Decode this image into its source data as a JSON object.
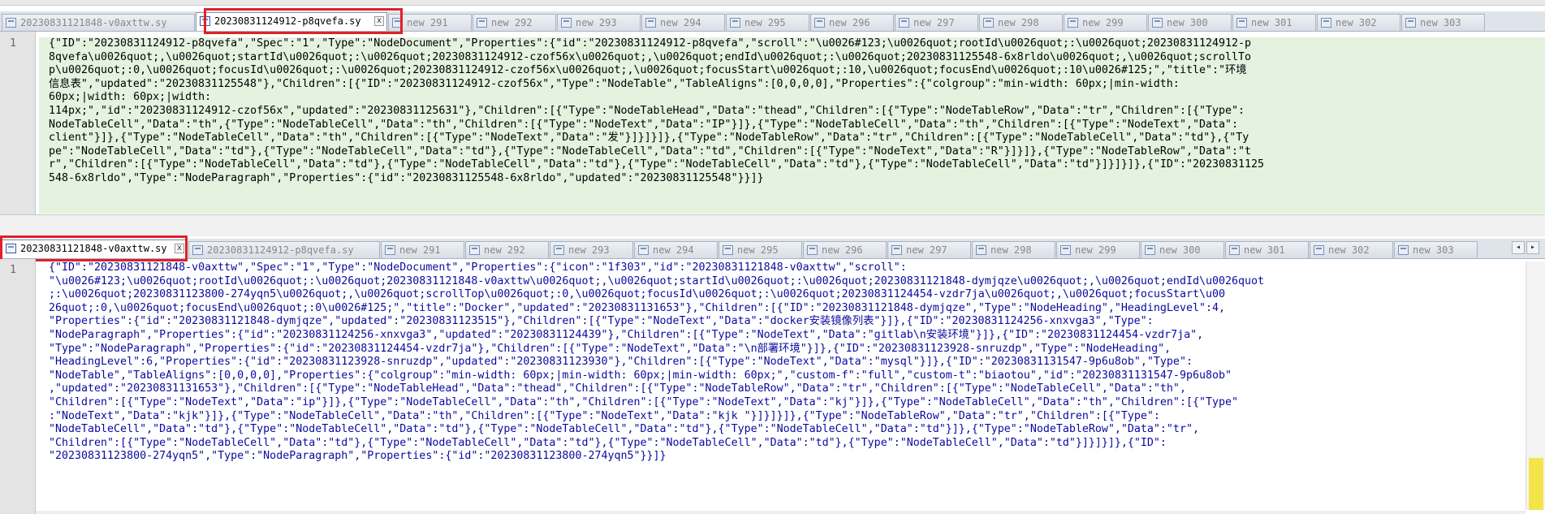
{
  "pane1": {
    "tabs": [
      {
        "label": "20230831121848-v0axttw.sy",
        "active": false
      },
      {
        "label": "20230831124912-p8qvefa.sy",
        "active": true
      },
      {
        "label": "new 291",
        "active": false
      },
      {
        "label": "new 292",
        "active": false
      },
      {
        "label": "new 293",
        "active": false
      },
      {
        "label": "new 294",
        "active": false
      },
      {
        "label": "new 295",
        "active": false
      },
      {
        "label": "new 296",
        "active": false
      },
      {
        "label": "new 297",
        "active": false
      },
      {
        "label": "new 298",
        "active": false
      },
      {
        "label": "new 299",
        "active": false
      },
      {
        "label": "new 300",
        "active": false
      },
      {
        "label": "new 301",
        "active": false
      },
      {
        "label": "new 302",
        "active": false
      },
      {
        "label": "new 303",
        "active": false
      }
    ],
    "line_number": "1",
    "close_label": "x",
    "lines": [
      "{\"ID\":\"20230831124912-p8qvefa\",\"Spec\":\"1\",\"Type\":\"NodeDocument\",\"Properties\":{\"id\":\"20230831124912-p8qvefa\",\"scroll\":\"\\u0026#123;\\u0026quot;rootId\\u0026quot;:\\u0026quot;20230831124912-p",
      "8qvefa\\u0026quot;,\\u0026quot;startId\\u0026quot;:\\u0026quot;20230831124912-czof56x\\u0026quot;,\\u0026quot;endId\\u0026quot;:\\u0026quot;20230831125548-6x8rldo\\u0026quot;,\\u0026quot;scrollTo",
      "p\\u0026quot;:0,\\u0026quot;focusId\\u0026quot;:\\u0026quot;20230831124912-czof56x\\u0026quot;,\\u0026quot;focusStart\\u0026quot;:10,\\u0026quot;focusEnd\\u0026quot;:10\\u0026#125;\",\"title\":\"环境",
      "信息表\",\"updated\":\"20230831125548\"},\"Children\":[{\"ID\":\"20230831124912-czof56x\",\"Type\":\"NodeTable\",\"TableAligns\":[0,0,0,0],\"Properties\":{\"colgroup\":\"min-width: 60px;|min-width:",
      "60px;|width: 60px;|width:",
      "114px;\",\"id\":\"20230831124912-czof56x\",\"updated\":\"20230831125631\"},\"Children\":[{\"Type\":\"NodeTableHead\",\"Data\":\"thead\",\"Children\":[{\"Type\":\"NodeTableRow\",\"Data\":\"tr\",\"Children\":[{\"Type\":",
      "NodeTableCell\",\"Data\":\"th\",{\"Type\":\"NodeTableCell\",\"Data\":\"th\",\"Children\":[{\"Type\":\"NodeText\",\"Data\":\"IP\"}]},{\"Type\":\"NodeTableCell\",\"Data\":\"th\",\"Children\":[{\"Type\":\"NodeText\",\"Data\":",
      "client\"}]},{\"Type\":\"NodeTableCell\",\"Data\":\"th\",\"Children\":[{\"Type\":\"NodeText\",\"Data\":\"发\"}]}]}]},{\"Type\":\"NodeTableRow\",\"Data\":\"tr\",\"Children\":[{\"Type\":\"NodeTableCell\",\"Data\":\"td\"},{\"Ty",
      "pe\":\"NodeTableCell\",\"Data\":\"td\"},{\"Type\":\"NodeTableCell\",\"Data\":\"td\"},{\"Type\":\"NodeTableCell\",\"Data\":\"td\",\"Children\":[{\"Type\":\"NodeText\",\"Data\":\"R\"}]}]},{\"Type\":\"NodeTableRow\",\"Data\":\"t",
      "r\",\"Children\":[{\"Type\":\"NodeTableCell\",\"Data\":\"td\"},{\"Type\":\"NodeTableCell\",\"Data\":\"td\"},{\"Type\":\"NodeTableCell\",\"Data\":\"td\"},{\"Type\":\"NodeTableCell\",\"Data\":\"td\"}]}]}]},{\"ID\":\"20230831125",
      "548-6x8rldo\",\"Type\":\"NodeParagraph\",\"Properties\":{\"id\":\"20230831125548-6x8rldo\",\"updated\":\"20230831125548\"}}]}"
    ]
  },
  "pane2": {
    "tabs": [
      {
        "label": "20230831121848-v0axttw.sy",
        "active": true
      },
      {
        "label": "20230831124912-p8qvefa.sy",
        "active": false
      },
      {
        "label": "new 291",
        "active": false
      },
      {
        "label": "new 292",
        "active": false
      },
      {
        "label": "new 293",
        "active": false
      },
      {
        "label": "new 294",
        "active": false
      },
      {
        "label": "new 295",
        "active": false
      },
      {
        "label": "new 296",
        "active": false
      },
      {
        "label": "new 297",
        "active": false
      },
      {
        "label": "new 298",
        "active": false
      },
      {
        "label": "new 299",
        "active": false
      },
      {
        "label": "new 300",
        "active": false
      },
      {
        "label": "new 301",
        "active": false
      },
      {
        "label": "new 302",
        "active": false
      },
      {
        "label": "new 303",
        "active": false
      }
    ],
    "line_number": "1",
    "close_label": "x",
    "nav_left": "◂",
    "nav_right": "▸",
    "lines": [
      "{\"ID\":\"20230831121848-v0axttw\",\"Spec\":\"1\",\"Type\":\"NodeDocument\",\"Properties\":{\"icon\":\"1f303\",\"id\":\"20230831121848-v0axttw\",\"scroll\":",
      "\"\\u0026#123;\\u0026quot;rootId\\u0026quot;:\\u0026quot;20230831121848-v0axttw\\u0026quot;,\\u0026quot;startId\\u0026quot;:\\u0026quot;20230831121848-dymjqze\\u0026quot;,\\u0026quot;endId\\u0026quot",
      ";:\\u0026quot;20230831123800-274yqn5\\u0026quot;,\\u0026quot;scrollTop\\u0026quot;:0,\\u0026quot;focusId\\u0026quot;:\\u0026quot;20230831124454-vzdr7ja\\u0026quot;,\\u0026quot;focusStart\\u00",
      "26quot;:0,\\u0026quot;focusEnd\\u0026quot;:0\\u0026#125;\",\"title\":\"Docker\",\"updated\":\"20230831131653\"},\"Children\":[{\"ID\":\"20230831121848-dymjqze\",\"Type\":\"NodeHeading\",\"HeadingLevel\":4,",
      "\"Properties\":{\"id\":\"20230831121848-dymjqze\",\"updated\":\"20230831123515\"},\"Children\":[{\"Type\":\"NodeText\",\"Data\":\"docker安装镜像列表\"}]},{\"ID\":\"20230831124256-xnxvga3\",\"Type\":",
      "\"NodeParagraph\",\"Properties\":{\"id\":\"20230831124256-xnxvga3\",\"updated\":\"20230831124439\"},\"Children\":[{\"Type\":\"NodeText\",\"Data\":\"gitlab\\n安装环境\"}]},{\"ID\":\"20230831124454-vzdr7ja\",",
      "\"Type\":\"NodeParagraph\",\"Properties\":{\"id\":\"20230831124454-vzdr7ja\"},\"Children\":[{\"Type\":\"NodeText\",\"Data\":\"\\n部署环境\"}]},{\"ID\":\"20230831123928-snruzdp\",\"Type\":\"NodeHeading\",",
      "\"HeadingLevel\":6,\"Properties\":{\"id\":\"20230831123928-snruzdp\",\"updated\":\"20230831123930\"},\"Children\":[{\"Type\":\"NodeText\",\"Data\":\"mysql\"}]},{\"ID\":\"20230831131547-9p6u8ob\",\"Type\":",
      "\"NodeTable\",\"TableAligns\":[0,0,0,0],\"Properties\":{\"colgroup\":\"min-width: 60px;|min-width: 60px;|min-width: 60px;\",\"custom-f\":\"full\",\"custom-t\":\"biaotou\",\"id\":\"20230831131547-9p6u8ob\"",
      ",\"updated\":\"20230831131653\"},\"Children\":[{\"Type\":\"NodeTableHead\",\"Data\":\"thead\",\"Children\":[{\"Type\":\"NodeTableRow\",\"Data\":\"tr\",\"Children\":[{\"Type\":\"NodeTableCell\",\"Data\":\"th\",",
      "\"Children\":[{\"Type\":\"NodeText\",\"Data\":\"ip\"}]},{\"Type\":\"NodeTableCell\",\"Data\":\"th\",\"Children\":[{\"Type\":\"NodeText\",\"Data\":\"kj\"}]},{\"Type\":\"NodeTableCell\",\"Data\":\"th\",\"Children\":[{\"Type\"",
      ":\"NodeText\",\"Data\":\"kjk\"}]},{\"Type\":\"NodeTableCell\",\"Data\":\"th\",\"Children\":[{\"Type\":\"NodeText\",\"Data\":\"kjk \"}]}]}]},{\"Type\":\"NodeTableRow\",\"Data\":\"tr\",\"Children\":[{\"Type\":",
      "\"NodeTableCell\",\"Data\":\"td\"},{\"Type\":\"NodeTableCell\",\"Data\":\"td\"},{\"Type\":\"NodeTableCell\",\"Data\":\"td\"},{\"Type\":\"NodeTableCell\",\"Data\":\"td\"}]},{\"Type\":\"NodeTableRow\",\"Data\":\"tr\",",
      "\"Children\":[{\"Type\":\"NodeTableCell\",\"Data\":\"td\"},{\"Type\":\"NodeTableCell\",\"Data\":\"td\"},{\"Type\":\"NodeTableCell\",\"Data\":\"td\"},{\"Type\":\"NodeTableCell\",\"Data\":\"td\"}]}]}]},{\"ID\":",
      "\"20230831123800-274yqn5\",\"Type\":\"NodeParagraph\",\"Properties\":{\"id\":\"20230831123800-274yqn5\"}}]}"
    ]
  }
}
